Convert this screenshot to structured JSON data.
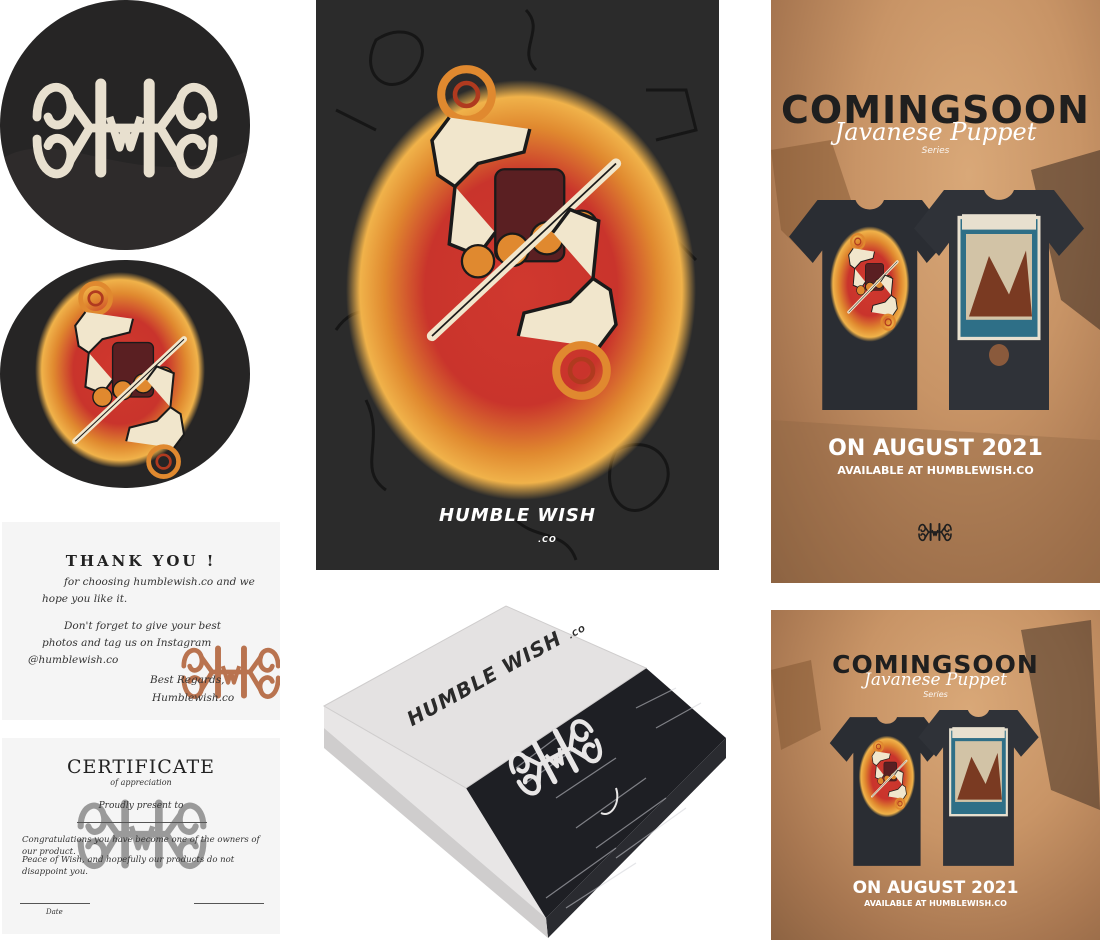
{
  "colors": {
    "dark": "#262525",
    "cream": "#e8e0cf",
    "red": "#c8372d",
    "orange": "#e0892f",
    "copper": "#b9734f",
    "promo_bg": "#c89466"
  },
  "icons": [
    "hw-monogram-logo",
    "wayang-puppet-artwork",
    "tshirt-mockup"
  ],
  "poster": {
    "brand": "HUMBLE WISH",
    "brand_suffix": ".CO"
  },
  "promo_large": {
    "title": "COMINGSOON",
    "script": "Javanese Puppet",
    "script_sub": "Series",
    "date": "ON AUGUST 2021",
    "available": "AVAILABLE AT HUMBLEWISH.CO"
  },
  "promo_small": {
    "title": "COMINGSOON",
    "script": "Javanese Puppet",
    "script_sub": "Series",
    "date": "ON AUGUST 2021",
    "available": "AVAILABLE AT HUMBLEWISH.CO"
  },
  "thankyou": {
    "title": "THANK YOU !",
    "line1": "for choosing humblewish.co and we",
    "line2": "hope you like it.",
    "line3": "Don't forget to give your best",
    "line4": "photos and tag us on Instagram",
    "line5": "@humblewish.co",
    "regards": "Best Regards,",
    "signature": "Humblewish.co"
  },
  "certificate": {
    "title": "CERTIFICATE",
    "subtitle": "of appreciation",
    "presented": "Proudly present to",
    "line1": "Congratulations you have become one of the owners of our product.",
    "line2": "Peace of Wish, and hopefully our products do not disappoint you.",
    "date_label": "Date"
  },
  "box": {
    "brand": "HUMBLE WISH",
    "brand_suffix": ".CO"
  }
}
